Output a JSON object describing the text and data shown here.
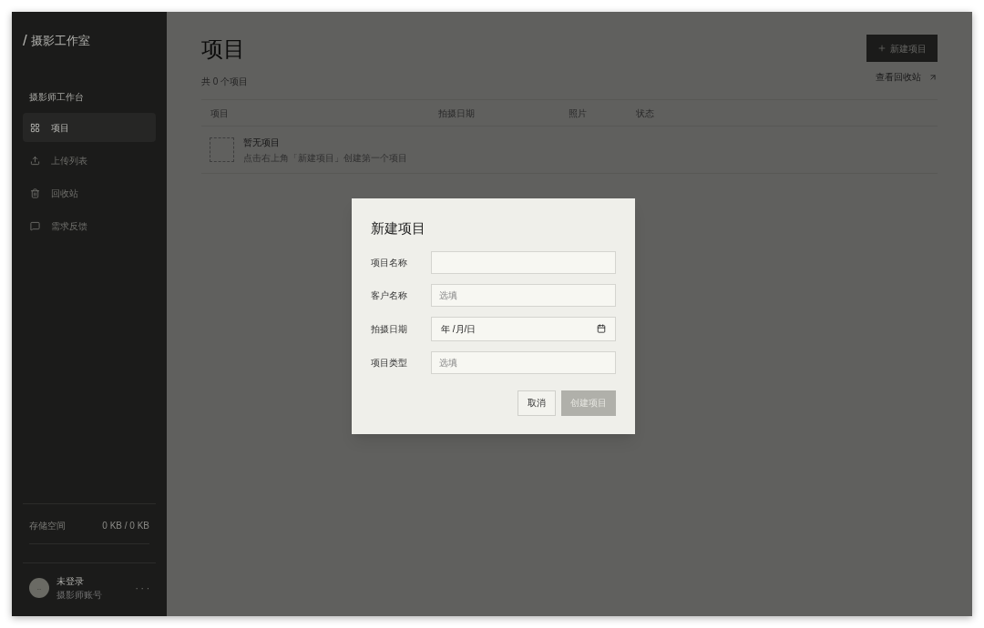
{
  "sidebar": {
    "brand_mark": "/",
    "brand": "摄影工作室",
    "section": "摄影师工作台",
    "items": [
      {
        "label": "项目",
        "selected": true
      },
      {
        "label": "上传列表",
        "selected": false
      },
      {
        "label": "回收站",
        "selected": false
      },
      {
        "label": "需求反馈",
        "selected": false
      }
    ],
    "storage": {
      "label": "存储空间",
      "value": "0 KB / 0 KB"
    },
    "user": {
      "avatar": "..",
      "name": "未登录",
      "subtitle": "摄影师账号",
      "more": "· · ·"
    }
  },
  "page": {
    "title": "项目",
    "count": "共 0 个项目",
    "new_button": "新建项目",
    "trash_link": "查看回收站",
    "table": {
      "columns": [
        "项目",
        "拍摄日期",
        "照片",
        "状态"
      ],
      "empty_title": "暂无项目",
      "empty_hint": "点击右上角「新建项目」创建第一个项目"
    }
  },
  "dialog": {
    "title": "新建项目",
    "fields": [
      {
        "label": "项目名称",
        "kind": "text"
      },
      {
        "label": "客户名称",
        "kind": "text",
        "placeholder": "选填"
      },
      {
        "label": "拍摄日期",
        "kind": "date",
        "value": "年 /月/日"
      },
      {
        "label": "项目类型",
        "kind": "text",
        "placeholder": "选填"
      }
    ],
    "cancel": "取消",
    "submit": "创建项目",
    "submit_disabled": true
  }
}
